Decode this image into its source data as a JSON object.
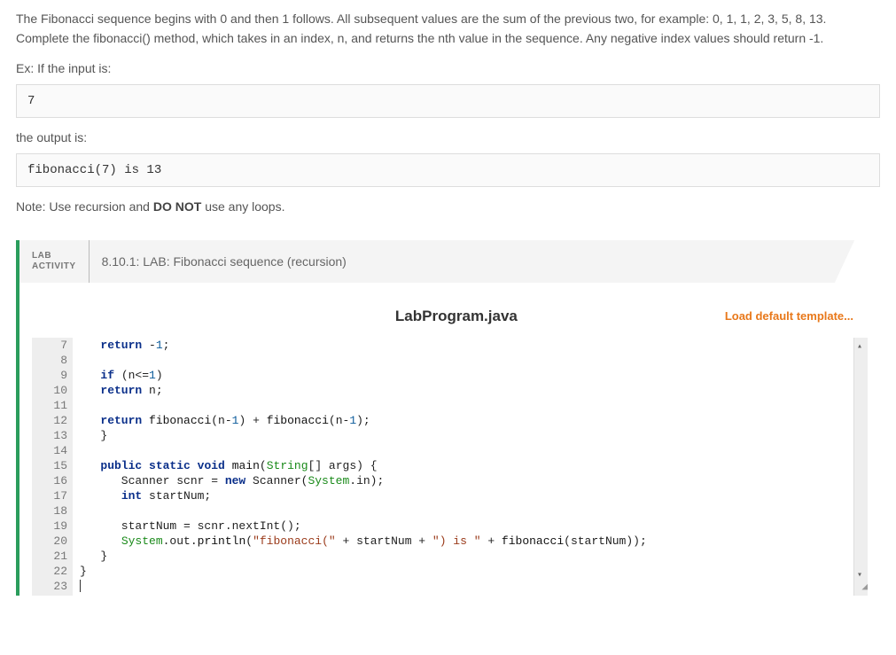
{
  "description": "The Fibonacci sequence begins with 0 and then 1 follows. All subsequent values are the sum of the previous two, for example: 0, 1, 1, 2, 3, 5, 8, 13. Complete the fibonacci() method, which takes in an index, n, and returns the nth value in the sequence. Any negative index values should return -1.",
  "input_label": "Ex: If the input is:",
  "input_example": "7",
  "output_label": "the output is:",
  "output_example": "fibonacci(7) is 13",
  "note_prefix": "Note: Use recursion and ",
  "note_bold": "DO NOT",
  "note_suffix": " use any loops.",
  "lab": {
    "tab_line1": "LAB",
    "tab_line2": "ACTIVITY",
    "title": "8.10.1: LAB: Fibonacci sequence (recursion)"
  },
  "editor": {
    "filename": "LabProgram.java",
    "load_template": "Load default template...",
    "first_line_number": 7,
    "lines": [
      {
        "n": 7,
        "tokens": [
          {
            "t": "   "
          },
          {
            "t": "return",
            "c": "kw"
          },
          {
            "t": " -"
          },
          {
            "t": "1",
            "c": "num"
          },
          {
            "t": ";"
          }
        ]
      },
      {
        "n": 8,
        "tokens": [
          {
            "t": ""
          }
        ]
      },
      {
        "n": 9,
        "tokens": [
          {
            "t": "   "
          },
          {
            "t": "if",
            "c": "kw"
          },
          {
            "t": " (n<="
          },
          {
            "t": "1",
            "c": "num"
          },
          {
            "t": ")"
          }
        ]
      },
      {
        "n": 10,
        "tokens": [
          {
            "t": "   "
          },
          {
            "t": "return",
            "c": "kw"
          },
          {
            "t": " n;"
          }
        ]
      },
      {
        "n": 11,
        "tokens": [
          {
            "t": ""
          }
        ]
      },
      {
        "n": 12,
        "tokens": [
          {
            "t": "   "
          },
          {
            "t": "return",
            "c": "kw"
          },
          {
            "t": " "
          },
          {
            "t": "fibonacci",
            "c": "fn"
          },
          {
            "t": "(n-"
          },
          {
            "t": "1",
            "c": "num"
          },
          {
            "t": ") + "
          },
          {
            "t": "fibonacci",
            "c": "fn"
          },
          {
            "t": "(n-"
          },
          {
            "t": "1",
            "c": "num"
          },
          {
            "t": ");"
          }
        ]
      },
      {
        "n": 13,
        "tokens": [
          {
            "t": "   }"
          }
        ]
      },
      {
        "n": 14,
        "tokens": [
          {
            "t": ""
          }
        ]
      },
      {
        "n": 15,
        "tokens": [
          {
            "t": "   "
          },
          {
            "t": "public",
            "c": "kw"
          },
          {
            "t": " "
          },
          {
            "t": "static",
            "c": "kw"
          },
          {
            "t": " "
          },
          {
            "t": "void",
            "c": "kw"
          },
          {
            "t": " "
          },
          {
            "t": "main",
            "c": "fn"
          },
          {
            "t": "("
          },
          {
            "t": "String",
            "c": "type"
          },
          {
            "t": "[] args) {"
          }
        ]
      },
      {
        "n": 16,
        "tokens": [
          {
            "t": "      Scanner scnr = "
          },
          {
            "t": "new",
            "c": "kw"
          },
          {
            "t": " Scanner("
          },
          {
            "t": "System",
            "c": "type"
          },
          {
            "t": ".in);"
          }
        ]
      },
      {
        "n": 17,
        "tokens": [
          {
            "t": "      "
          },
          {
            "t": "int",
            "c": "kw"
          },
          {
            "t": " startNum;"
          }
        ]
      },
      {
        "n": 18,
        "tokens": [
          {
            "t": ""
          }
        ]
      },
      {
        "n": 19,
        "tokens": [
          {
            "t": "      startNum = scnr.nextInt();"
          }
        ]
      },
      {
        "n": 20,
        "tokens": [
          {
            "t": "      "
          },
          {
            "t": "System",
            "c": "type"
          },
          {
            "t": ".out."
          },
          {
            "t": "println",
            "c": "fn"
          },
          {
            "t": "("
          },
          {
            "t": "\"fibonacci(\"",
            "c": "str"
          },
          {
            "t": " + startNum + "
          },
          {
            "t": "\") is \"",
            "c": "str"
          },
          {
            "t": " + "
          },
          {
            "t": "fibonacci",
            "c": "fn"
          },
          {
            "t": "(startNum));"
          }
        ]
      },
      {
        "n": 21,
        "tokens": [
          {
            "t": "   }"
          }
        ]
      },
      {
        "n": 22,
        "tokens": [
          {
            "t": "}"
          }
        ]
      },
      {
        "n": 23,
        "tokens": [
          {
            "t": ""
          }
        ],
        "cursor": true
      }
    ]
  }
}
